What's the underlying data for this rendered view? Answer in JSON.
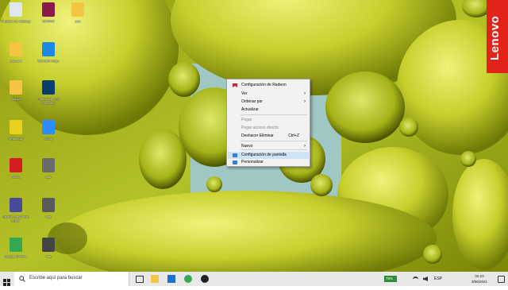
{
  "desktop_icons": [
    {
      "label": "Papelera de reciclaje",
      "icon": "recycle-bin-icon",
      "color": "#dfe6ee"
    },
    {
      "label": "WinRAR",
      "icon": "winrar-icon",
      "color": "#8b1a4a"
    },
    {
      "label": "aaa",
      "icon": "folder-icon",
      "color": "#f4c542"
    },
    {
      "label": "aaa aaa",
      "icon": "folder-icon",
      "color": "#f4c542"
    },
    {
      "label": "Microsoft Edge",
      "icon": "edge-icon",
      "color": "#1e88e5"
    },
    {
      "label": "Bajaja",
      "icon": "file-icon",
      "color": "#f4c542"
    },
    {
      "label": "Photoshop CS6 Extended",
      "icon": "photoshop-icon",
      "color": "#0b3c6e"
    },
    {
      "label": "WhatsApp",
      "icon": "app-icon",
      "color": "#e8d21f"
    },
    {
      "label": "Zoom",
      "icon": "zoom-icon",
      "color": "#2d8cff"
    },
    {
      "label": "Adobe",
      "icon": "pdf-icon",
      "color": "#d41d1d"
    },
    {
      "label": "aaa",
      "icon": "image-icon",
      "color": "#6b6b6b"
    },
    {
      "label": "Salami Easy Audio Editor",
      "icon": "audio-editor-icon",
      "color": "#4a4a9a"
    },
    {
      "label": "aaa",
      "icon": "image-icon",
      "color": "#5a5a5a"
    },
    {
      "label": "Google Chrome",
      "icon": "chrome-icon",
      "color": "#34a853"
    },
    {
      "label": "aaa",
      "icon": "image-icon",
      "color": "#444444"
    }
  ],
  "brand": "Lenovo",
  "context_menu": {
    "items": [
      {
        "label": "Configuración de Radeon",
        "icon": "radeon-icon",
        "disabled": false,
        "arrow": false,
        "shortcut": ""
      },
      {
        "label": "Ver",
        "disabled": false,
        "arrow": true,
        "shortcut": ""
      },
      {
        "label": "Ordenar por",
        "disabled": false,
        "arrow": true,
        "shortcut": ""
      },
      {
        "label": "Actualizar",
        "disabled": false,
        "arrow": false,
        "shortcut": ""
      },
      {
        "label": "Pegar",
        "disabled": true,
        "arrow": false,
        "shortcut": ""
      },
      {
        "label": "Pegar acceso directo",
        "disabled": true,
        "arrow": false,
        "shortcut": ""
      },
      {
        "label": "Deshacer Eliminar",
        "disabled": false,
        "arrow": false,
        "shortcut": "Ctrl+Z"
      },
      {
        "label": "Nuevo",
        "disabled": false,
        "arrow": true,
        "shortcut": ""
      },
      {
        "label": "Configuración de pantalla",
        "icon": "display-settings-icon",
        "disabled": false,
        "arrow": false,
        "shortcut": "",
        "highlighted": true
      },
      {
        "label": "Personalizar",
        "icon": "personalize-icon",
        "disabled": false,
        "arrow": false,
        "shortcut": ""
      }
    ]
  },
  "taskbar": {
    "search_placeholder": "Escribe aquí para buscar",
    "battery": "76%",
    "language": "ESP",
    "time": "02:23",
    "date": "3/06/2021"
  }
}
